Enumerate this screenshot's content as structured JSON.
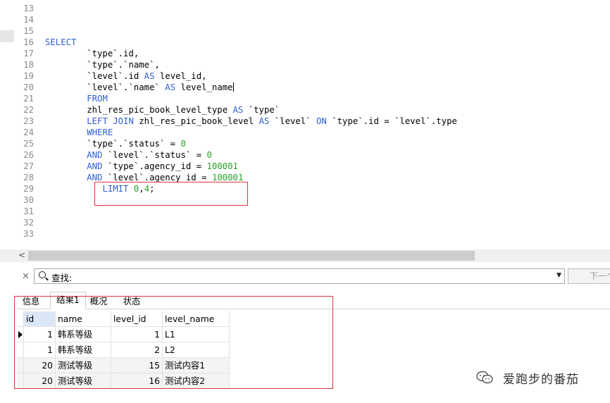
{
  "editor": {
    "lines": [
      {
        "n": "13",
        "segs": []
      },
      {
        "n": "14",
        "segs": []
      },
      {
        "n": "15",
        "segs": []
      },
      {
        "n": "16",
        "segs": [
          {
            "t": "SELECT",
            "c": "kw"
          }
        ]
      },
      {
        "n": "17",
        "segs": [
          {
            "t": "        `type`.id,",
            "c": ""
          }
        ]
      },
      {
        "n": "18",
        "segs": [
          {
            "t": "        `type`.`name`,",
            "c": ""
          }
        ]
      },
      {
        "n": "19",
        "segs": [
          {
            "t": "        `level`.id ",
            "c": ""
          },
          {
            "t": "AS",
            "c": "kw"
          },
          {
            "t": " level_id,",
            "c": ""
          }
        ]
      },
      {
        "n": "20",
        "segs": [
          {
            "t": "        `level`.`name` ",
            "c": ""
          },
          {
            "t": "AS",
            "c": "kw"
          },
          {
            "t": " level_name",
            "c": ""
          }
        ],
        "cursor": true
      },
      {
        "n": "21",
        "segs": [
          {
            "t": "        ",
            "c": ""
          },
          {
            "t": "FROM",
            "c": "kw"
          }
        ]
      },
      {
        "n": "22",
        "segs": [
          {
            "t": "        zhl_res_pic_book_level_type ",
            "c": ""
          },
          {
            "t": "AS",
            "c": "kw"
          },
          {
            "t": " `type`",
            "c": ""
          }
        ]
      },
      {
        "n": "23",
        "segs": [
          {
            "t": "        ",
            "c": ""
          },
          {
            "t": "LEFT JOIN",
            "c": "kw"
          },
          {
            "t": " zhl_res_pic_book_level ",
            "c": ""
          },
          {
            "t": "AS",
            "c": "kw"
          },
          {
            "t": " `level` ",
            "c": ""
          },
          {
            "t": "ON",
            "c": "kw"
          },
          {
            "t": " `type`.id = `level`.type",
            "c": ""
          }
        ]
      },
      {
        "n": "24",
        "segs": [
          {
            "t": "        ",
            "c": ""
          },
          {
            "t": "WHERE",
            "c": "kw"
          }
        ]
      },
      {
        "n": "25",
        "segs": [
          {
            "t": "        `type`.`status` = ",
            "c": ""
          },
          {
            "t": "0",
            "c": "num"
          }
        ]
      },
      {
        "n": "26",
        "segs": [
          {
            "t": "        ",
            "c": ""
          },
          {
            "t": "AND",
            "c": "kw"
          },
          {
            "t": " `level`.`status` = ",
            "c": ""
          },
          {
            "t": "0",
            "c": "num"
          }
        ]
      },
      {
        "n": "27",
        "segs": [
          {
            "t": "        ",
            "c": ""
          },
          {
            "t": "AND",
            "c": "kw"
          },
          {
            "t": " `type`.agency_id = ",
            "c": ""
          },
          {
            "t": "100001",
            "c": "num"
          }
        ]
      },
      {
        "n": "28",
        "segs": [
          {
            "t": "        ",
            "c": ""
          },
          {
            "t": "AND",
            "c": "kw"
          },
          {
            "t": " `level`.agency_id = ",
            "c": ""
          },
          {
            "t": "100001",
            "c": "num"
          }
        ]
      },
      {
        "n": "29",
        "segs": [
          {
            "t": "           ",
            "c": ""
          },
          {
            "t": "LIMIT",
            "c": "kw"
          },
          {
            "t": " ",
            "c": ""
          },
          {
            "t": "0",
            "c": "num"
          },
          {
            "t": ",",
            "c": ""
          },
          {
            "t": "4",
            "c": "num"
          },
          {
            "t": ";",
            "c": ""
          }
        ]
      },
      {
        "n": "30",
        "segs": []
      },
      {
        "n": "31",
        "segs": []
      },
      {
        "n": "32",
        "segs": []
      },
      {
        "n": "33",
        "segs": []
      }
    ]
  },
  "find": {
    "label": "查找:",
    "value": "",
    "next_label": "下一个"
  },
  "tabs": [
    {
      "label": "信息",
      "active": false
    },
    {
      "label": "结果1",
      "active": true
    },
    {
      "label": "概况",
      "active": false
    },
    {
      "label": "状态",
      "active": false
    }
  ],
  "results": {
    "columns": [
      "id",
      "name",
      "level_id",
      "level_name"
    ],
    "rows": [
      [
        "1",
        "韩系等级",
        "1",
        "L1"
      ],
      [
        "1",
        "韩系等级",
        "2",
        "L2"
      ],
      [
        "20",
        "测试等级",
        "15",
        "测试内容1"
      ],
      [
        "20",
        "测试等级",
        "16",
        "测试内容2"
      ]
    ]
  },
  "watermark": {
    "text": "爱跑步的番茄"
  },
  "colors": {
    "keyword": "#2f5fd0",
    "number": "#2aa02a",
    "highlight_box": "#d9363e"
  }
}
